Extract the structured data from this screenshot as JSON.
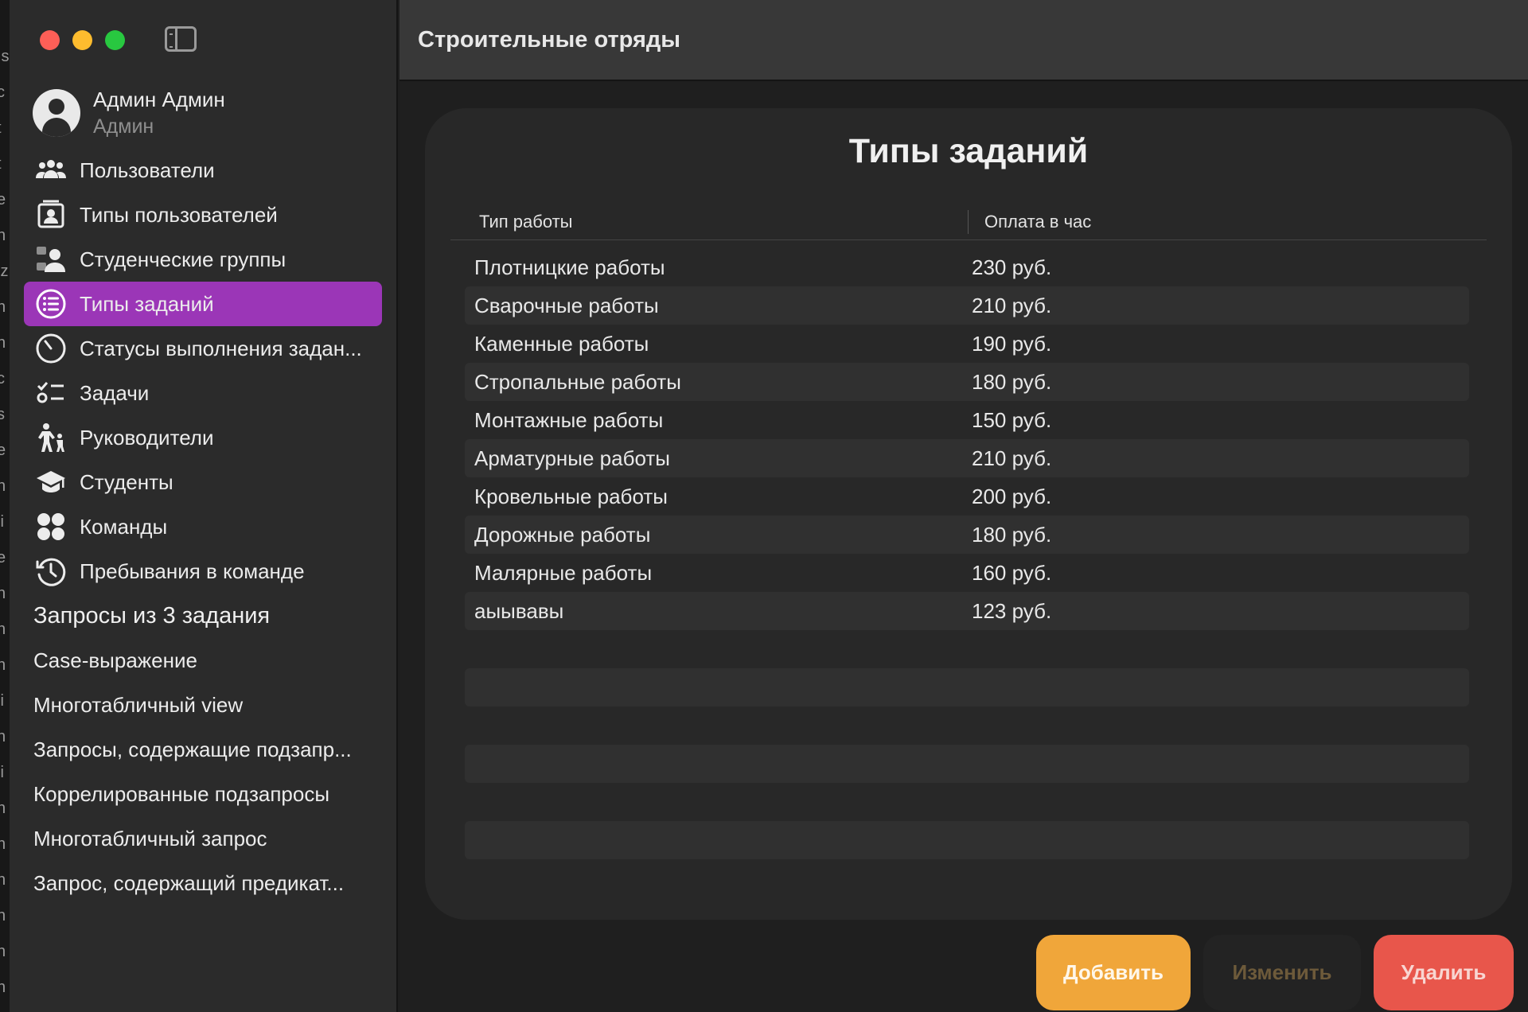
{
  "window": {
    "title": "Строительные отряды"
  },
  "profile": {
    "name": "Админ Админ",
    "role": "Админ"
  },
  "sidebar": {
    "items": [
      {
        "label": "Пользователи",
        "icon": "users-icon"
      },
      {
        "label": "Типы пользователей",
        "icon": "person-card-icon"
      },
      {
        "label": "Студенческие группы",
        "icon": "group-icon"
      },
      {
        "label": "Типы заданий",
        "icon": "list-bullet-icon",
        "active": true
      },
      {
        "label": "Статусы выполнения заданий",
        "icon": "clock-dial-icon"
      },
      {
        "label": "Задачи",
        "icon": "checklist-icon"
      },
      {
        "label": "Руководители",
        "icon": "figure-and-child-icon"
      },
      {
        "label": "Студенты",
        "icon": "graduation-cap-icon"
      },
      {
        "label": "Команды",
        "icon": "four-circles-icon"
      },
      {
        "label": "Пребывания в команде",
        "icon": "history-icon"
      }
    ],
    "section_title": "Запросы из 3 задания",
    "queries": [
      "Case-выражение",
      "Многотабличный view",
      "Запросы, содержащие подзапросы",
      "Коррелированные подзапросы",
      "Многотабличный запрос",
      "Запрос, содержащий предикат"
    ]
  },
  "card": {
    "title": "Типы заданий",
    "columns": [
      "Тип работы",
      "Оплата в час"
    ],
    "rows": [
      [
        "Плотницкие работы",
        "230 руб."
      ],
      [
        "Сварочные работы",
        "210 руб."
      ],
      [
        "Каменные работы",
        "190 руб."
      ],
      [
        "Стропальные работы",
        "180 руб."
      ],
      [
        "Монтажные работы",
        "150 руб."
      ],
      [
        "Арматурные работы",
        "210 руб."
      ],
      [
        "Кровельные работы",
        "200 руб."
      ],
      [
        "Дорожные работы",
        "180 руб."
      ],
      [
        "Малярные работы",
        "160 руб."
      ],
      [
        "аыывавы",
        "123 руб."
      ],
      [
        "",
        ""
      ],
      [
        "",
        ""
      ],
      [
        "",
        ""
      ],
      [
        "",
        ""
      ],
      [
        "",
        ""
      ],
      [
        "",
        ""
      ]
    ]
  },
  "buttons": {
    "add": "Добавить",
    "edit": "Изменить",
    "delete": "Удалить"
  },
  "colors": {
    "accent": "#9b36b7",
    "add": "#f0a63a",
    "delete": "#e8564b"
  }
}
